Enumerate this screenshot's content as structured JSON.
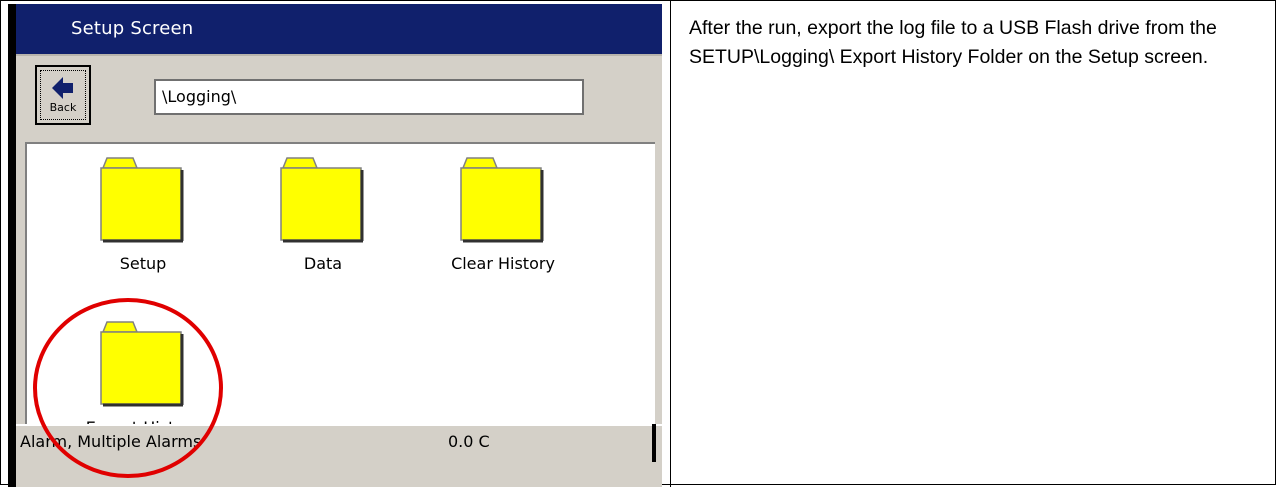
{
  "instruction": {
    "text": "After the run, export the log file to a USB Flash drive from the SETUP\\Logging\\ Export History Folder on the Setup screen."
  },
  "screen": {
    "title": "Setup Screen",
    "back_button": {
      "label": "Back",
      "icon": "back-arrow-icon"
    },
    "path": "\\Logging\\",
    "folders": [
      {
        "label": "Setup",
        "icon": "folder-icon"
      },
      {
        "label": "Data",
        "icon": "folder-icon"
      },
      {
        "label": "Clear History",
        "icon": "folder-icon"
      },
      {
        "label": "Export History",
        "icon": "folder-icon"
      }
    ],
    "status": {
      "alarm": "Alarm, Multiple Alarms",
      "temperature": "0.0 C"
    }
  },
  "colors": {
    "titlebar": "#10206c",
    "folder_fill": "#ffff00",
    "highlight": "#e00000",
    "panel": "#d4d0c8"
  }
}
